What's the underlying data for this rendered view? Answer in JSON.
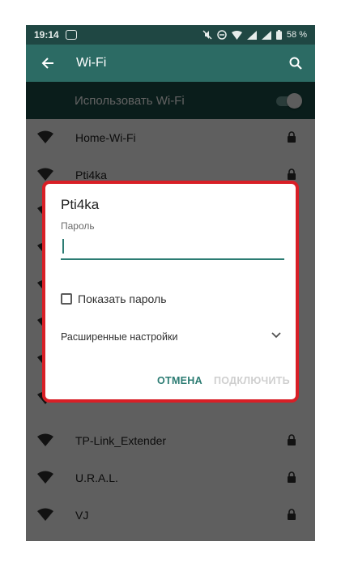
{
  "statusbar": {
    "time": "19:14",
    "battery": "58 %"
  },
  "appbar": {
    "title": "Wi-Fi"
  },
  "toggle": {
    "label": "Использовать Wi-Fi",
    "enabled": true
  },
  "networks": [
    {
      "name": "Home-Wi-Fi",
      "secured": true
    },
    {
      "name": "Pti4ka",
      "secured": true
    },
    {
      "name": "TP-Link_Extender",
      "secured": true
    },
    {
      "name": "U.R.A.L.",
      "secured": true
    },
    {
      "name": "VJ",
      "secured": true
    }
  ],
  "dialog": {
    "title": "Pti4ka",
    "password_label": "Пароль",
    "password_value": "",
    "show_password_label": "Показать пароль",
    "show_password_checked": false,
    "advanced_label": "Расширенные настройки",
    "cancel_label": "ОТМЕНА",
    "connect_label": "ПОДКЛЮЧИТЬ"
  },
  "colors": {
    "accent": "#2c7c73",
    "appbar": "#2c6b64",
    "highlight": "#d81f26"
  },
  "icons": [
    "back-arrow-icon",
    "search-icon",
    "wifi-signal-icon",
    "lock-icon",
    "chevron-down-icon",
    "mute-icon",
    "dnd-icon",
    "battery-icon"
  ]
}
